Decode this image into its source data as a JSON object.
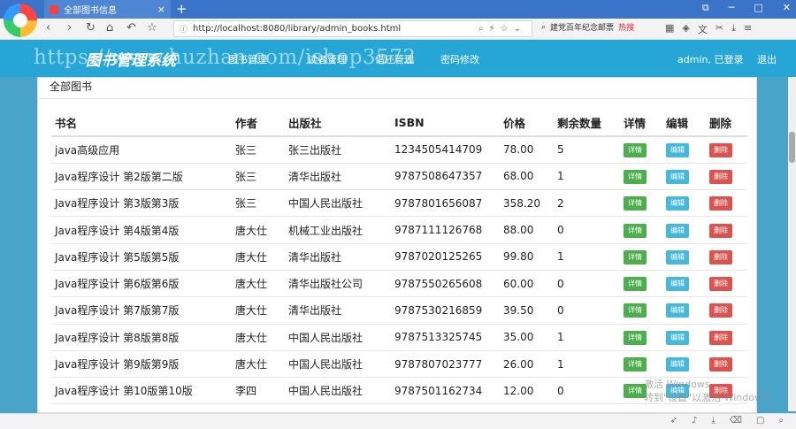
{
  "browser": {
    "tab_title": "全部图书信息",
    "url": "http://localhost:8080/library/admin_books.html",
    "search_text": "建党百年纪念邮票",
    "hot_label": "热搜"
  },
  "app": {
    "brand": "图书管理系统",
    "nav": [
      "图书管理",
      "读者管理",
      "借还管理",
      "密码修改"
    ],
    "user": "admin, 已登录",
    "logout": "退出",
    "watermark": "https://www.huzhan.com/ishop3572"
  },
  "panel": {
    "title": "全部图书"
  },
  "table": {
    "headers": [
      "书名",
      "作者",
      "出版社",
      "ISBN",
      "价格",
      "剩余数量",
      "详情",
      "编辑",
      "删除"
    ],
    "detail_label": "详情",
    "edit_label": "编辑",
    "delete_label": "删除",
    "rows": [
      {
        "name": "java高级应用",
        "author": "张三",
        "publisher": "张三出版社",
        "isbn": "1234505414709",
        "price": "78.00",
        "qty": "5"
      },
      {
        "name": "Java程序设计 第2版第二版",
        "author": "张三",
        "publisher": "清华出版社",
        "isbn": "9787508647357",
        "price": "68.00",
        "qty": "1"
      },
      {
        "name": "Java程序设计 第3版第3版",
        "author": "张三",
        "publisher": "中国人民出版社",
        "isbn": "9787801656087",
        "price": "358.20",
        "qty": "2"
      },
      {
        "name": "Java程序设计 第4版第4版",
        "author": "唐大仕",
        "publisher": "机械工业出版社",
        "isbn": "9787111126768",
        "price": "88.00",
        "qty": "0"
      },
      {
        "name": "Java程序设计 第5版第5版",
        "author": "唐大仕",
        "publisher": "清华出版社",
        "isbn": "9787020125265",
        "price": "99.80",
        "qty": "1"
      },
      {
        "name": "Java程序设计 第6版第6版",
        "author": "唐大仕",
        "publisher": "清华出版社公司",
        "isbn": "9787550265608",
        "price": "60.00",
        "qty": "0"
      },
      {
        "name": "Java程序设计 第7版第7版",
        "author": "唐大仕",
        "publisher": "清华出版社",
        "isbn": "9787530216859",
        "price": "39.50",
        "qty": "0"
      },
      {
        "name": "Java程序设计 第8版第8版",
        "author": "唐大仕",
        "publisher": "中国人民出版社",
        "isbn": "9787513325745",
        "price": "35.00",
        "qty": "1"
      },
      {
        "name": "Java程序设计 第9版第9版",
        "author": "唐大仕",
        "publisher": "中国人民出版社",
        "isbn": "9787807023777",
        "price": "26.00",
        "qty": "1"
      },
      {
        "name": "Java程序设计 第10版第10版",
        "author": "李四",
        "publisher": "中国人民出版社",
        "isbn": "9787501162734",
        "price": "12.00",
        "qty": "0"
      }
    ]
  },
  "overlay": {
    "activate_line1": "激活 Windows",
    "activate_line2": "转到\"设置\"以激活 Windows。"
  }
}
